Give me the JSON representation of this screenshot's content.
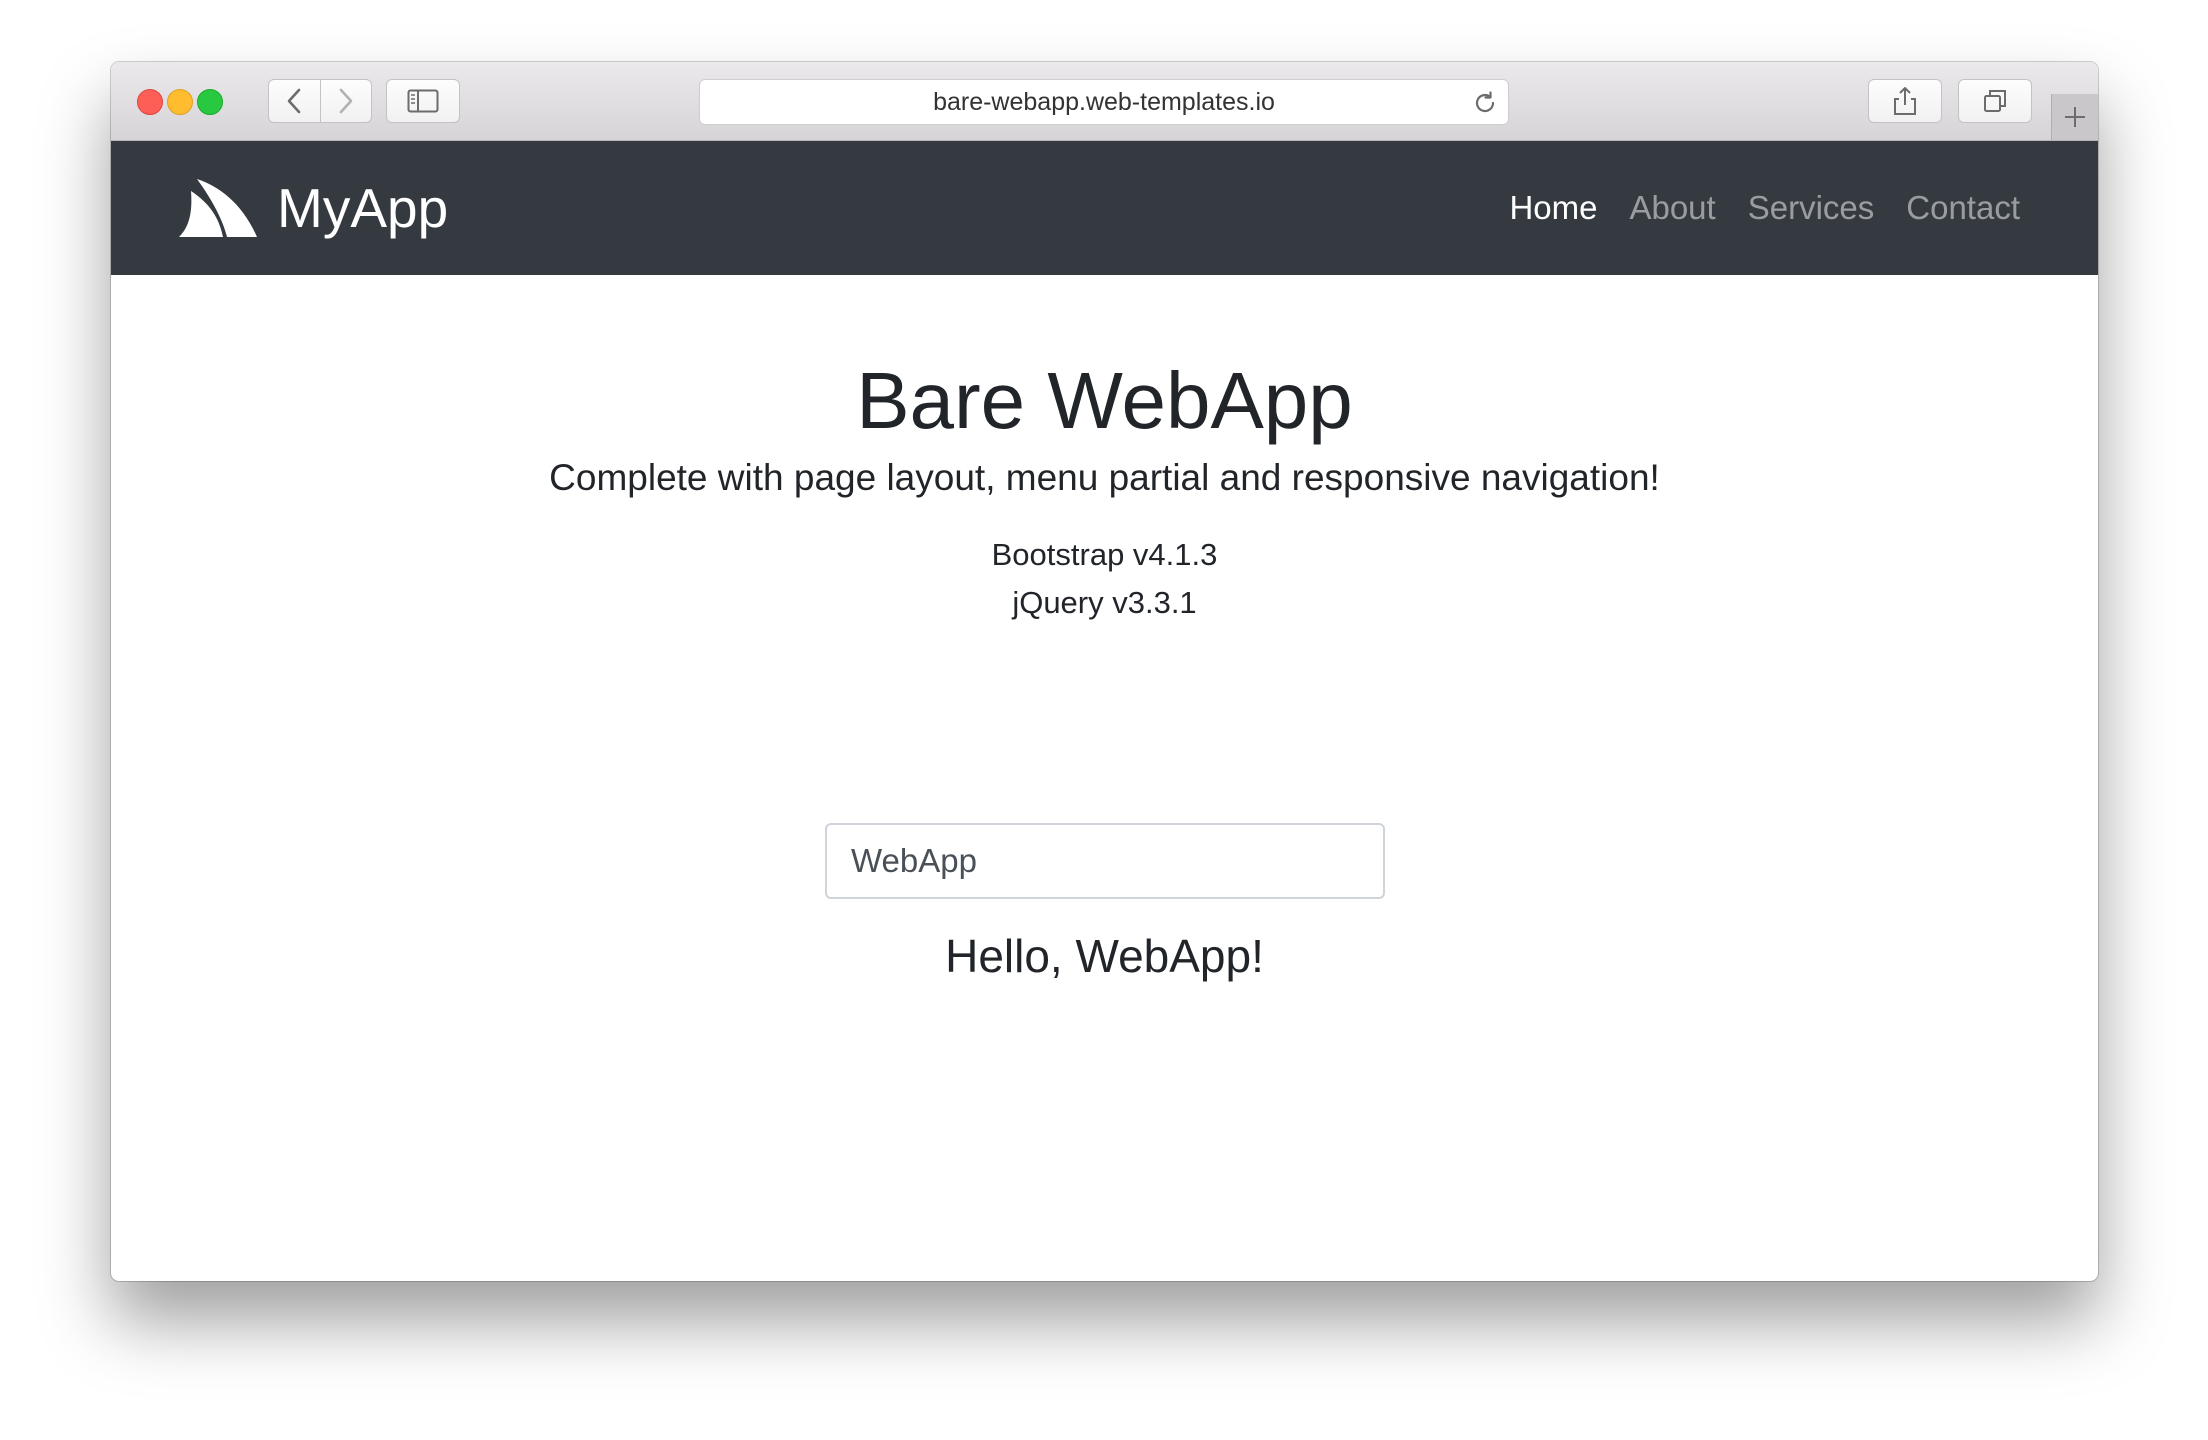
{
  "browser": {
    "url": "bare-webapp.web-templates.io",
    "icons": {
      "back": "chevron-left-icon",
      "forward": "chevron-right-icon",
      "sidebar": "sidebar-icon",
      "reload": "reload-icon",
      "share": "share-icon",
      "tabs": "tabs-overview-icon",
      "new_tab": "plus-icon"
    }
  },
  "navbar": {
    "brand": "MyApp",
    "brand_logo": "shark-fin-logo-icon",
    "links": [
      {
        "label": "Home",
        "active": true
      },
      {
        "label": "About",
        "active": false
      },
      {
        "label": "Services",
        "active": false
      },
      {
        "label": "Contact",
        "active": false
      }
    ]
  },
  "main": {
    "title": "Bare WebApp",
    "lead": "Complete with page layout, menu partial and responsive navigation!",
    "versions": [
      "Bootstrap v4.1.3",
      "jQuery v3.3.1"
    ],
    "input_value": "WebApp",
    "greeting": "Hello, WebApp!"
  },
  "colors": {
    "navbar_bg": "#343a40",
    "text": "#212529",
    "nav_link_inactive": "rgba(255,255,255,0.5)",
    "nav_link_active": "#ffffff"
  }
}
